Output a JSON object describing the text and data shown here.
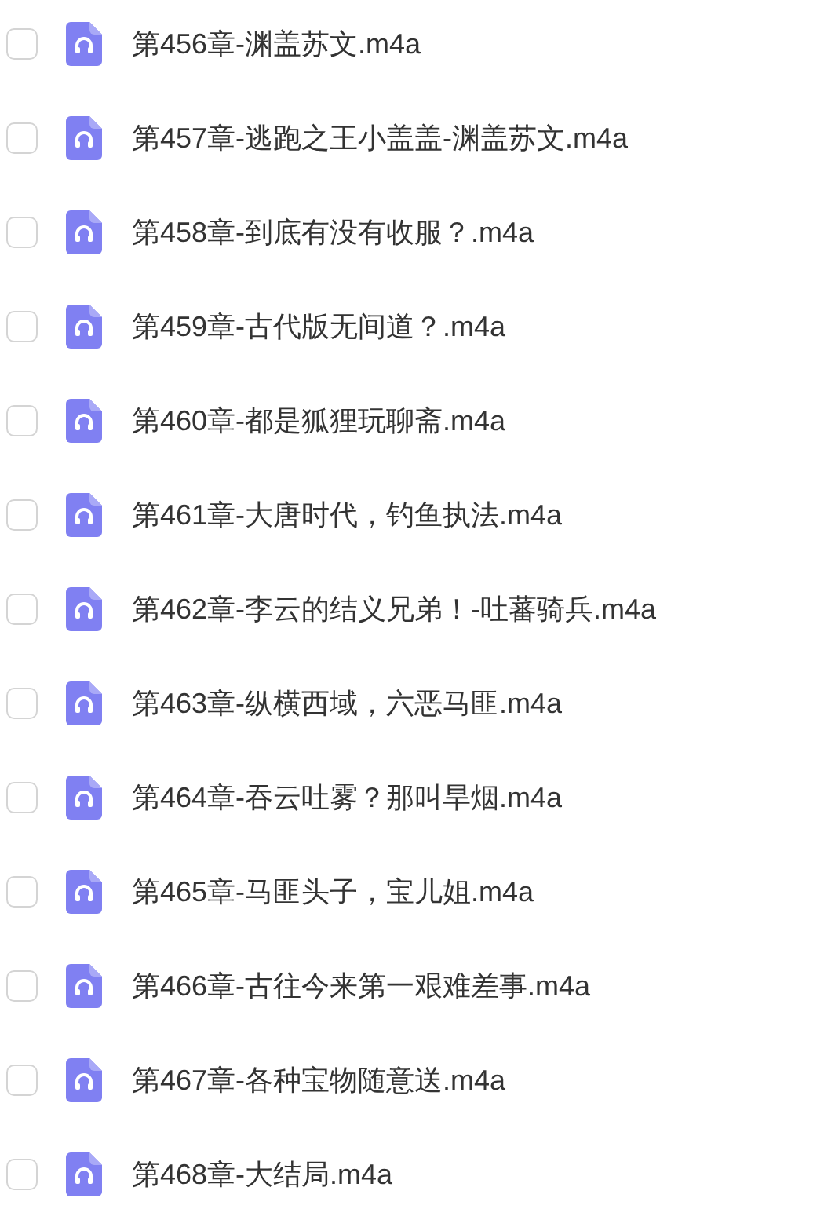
{
  "files": [
    {
      "name": "第456章-渊盖苏文.m4a",
      "checked": false
    },
    {
      "name": "第457章-逃跑之王小盖盖-渊盖苏文.m4a",
      "checked": false
    },
    {
      "name": "第458章-到底有没有收服？.m4a",
      "checked": false
    },
    {
      "name": "第459章-古代版无间道？.m4a",
      "checked": false
    },
    {
      "name": "第460章-都是狐狸玩聊斋.m4a",
      "checked": false
    },
    {
      "name": "第461章-大唐时代，钓鱼执法.m4a",
      "checked": false
    },
    {
      "name": "第462章-李云的结义兄弟！-吐蕃骑兵.m4a",
      "checked": false
    },
    {
      "name": "第463章-纵横西域，六恶马匪.m4a",
      "checked": false
    },
    {
      "name": "第464章-吞云吐雾？那叫旱烟.m4a",
      "checked": false
    },
    {
      "name": "第465章-马匪头子，宝儿姐.m4a",
      "checked": false
    },
    {
      "name": "第466章-古往今来第一艰难差事.m4a",
      "checked": false
    },
    {
      "name": "第467章-各种宝物随意送.m4a",
      "checked": false
    },
    {
      "name": "第468章-大结局.m4a",
      "checked": false
    }
  ]
}
